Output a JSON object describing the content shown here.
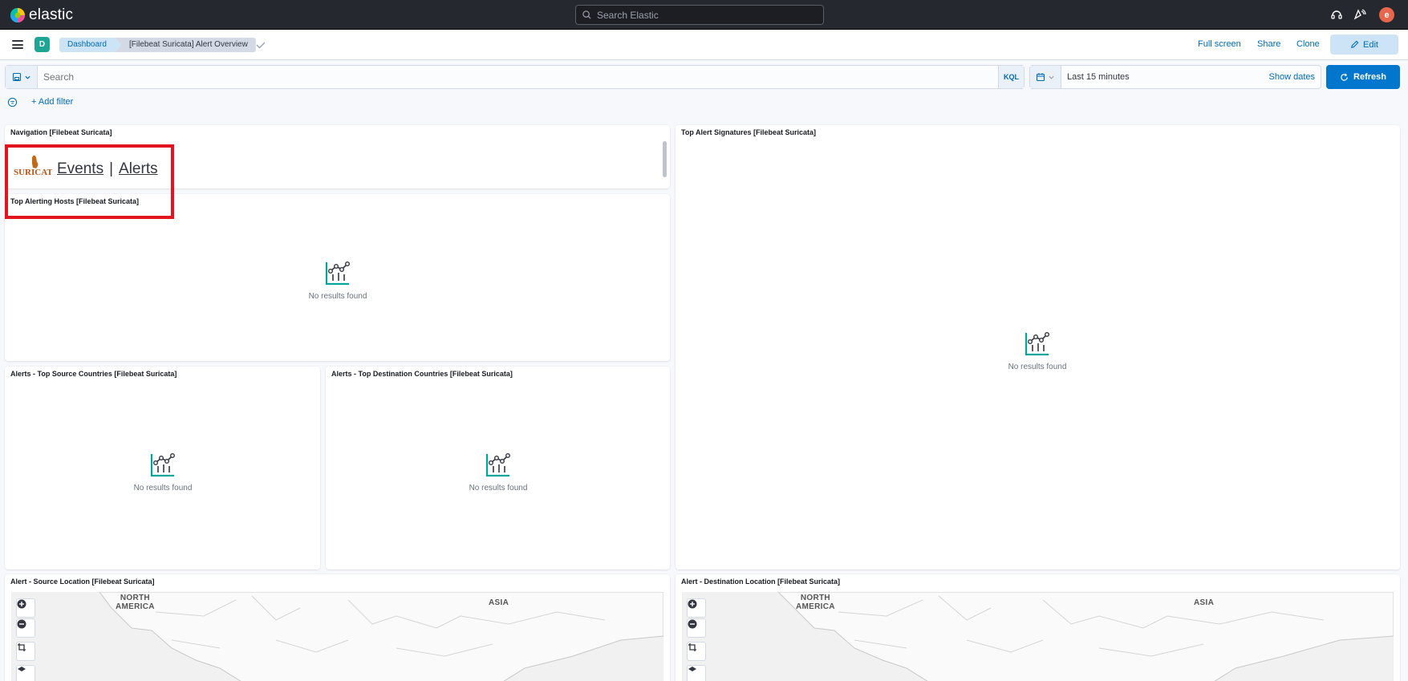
{
  "header": {
    "brand": "elastic",
    "search_placeholder": "Search Elastic",
    "avatar_initial": "e"
  },
  "subheader": {
    "space_badge": "D",
    "breadcrumbs": [
      "Dashboard",
      "[Filebeat Suricata] Alert Overview"
    ],
    "actions": {
      "full_screen": "Full screen",
      "share": "Share",
      "clone": "Clone",
      "edit": "Edit"
    }
  },
  "query_bar": {
    "search_placeholder": "Search",
    "language": "KQL",
    "time_range": "Last 15 minutes",
    "show_dates": "Show dates",
    "refresh": "Refresh",
    "add_filter": "+ Add filter"
  },
  "panels": {
    "navigation": {
      "title": "Navigation [Filebeat Suricata]",
      "logo_text": "SURICATA",
      "links": [
        "Events",
        "Alerts"
      ],
      "separator": "|"
    },
    "top_alerting_hosts": {
      "title": "Top Alerting Hosts [Filebeat Suricata]",
      "empty": "No results found"
    },
    "top_alert_signatures": {
      "title": "Top Alert Signatures [Filebeat Suricata]",
      "empty": "No results found"
    },
    "top_source_countries": {
      "title": "Alerts - Top Source Countries [Filebeat Suricata]",
      "empty": "No results found"
    },
    "top_destination_countries": {
      "title": "Alerts - Top Destination Countries [Filebeat Suricata]",
      "empty": "No results found"
    },
    "source_location": {
      "title": "Alert - Source Location [Filebeat Suricata]",
      "map_labels": [
        "NORTH AMERICA",
        "ASIA"
      ]
    },
    "destination_location": {
      "title": "Alert - Destination Location [Filebeat Suricata]",
      "map_labels": [
        "NORTH AMERICA",
        "ASIA"
      ]
    }
  },
  "colors": {
    "accent": "#006bb8",
    "primary_button": "#0077cc",
    "highlight_box": "#e1141f",
    "empty_icon": "#00a69b"
  }
}
